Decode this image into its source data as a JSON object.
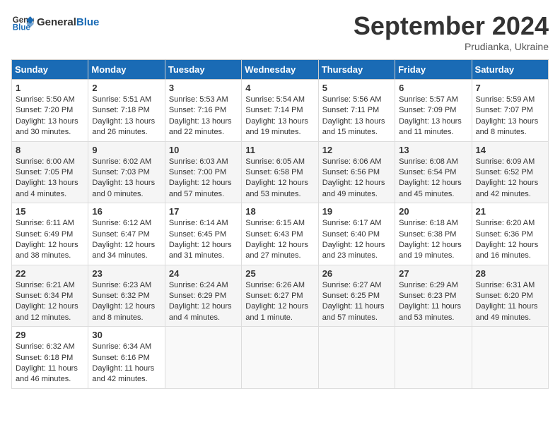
{
  "header": {
    "logo_line1": "General",
    "logo_line2": "Blue",
    "month": "September 2024",
    "location": "Prudianka, Ukraine"
  },
  "weekdays": [
    "Sunday",
    "Monday",
    "Tuesday",
    "Wednesday",
    "Thursday",
    "Friday",
    "Saturday"
  ],
  "weeks": [
    [
      {
        "day": "1",
        "sunrise": "Sunrise: 5:50 AM",
        "sunset": "Sunset: 7:20 PM",
        "daylight": "Daylight: 13 hours and 30 minutes."
      },
      {
        "day": "2",
        "sunrise": "Sunrise: 5:51 AM",
        "sunset": "Sunset: 7:18 PM",
        "daylight": "Daylight: 13 hours and 26 minutes."
      },
      {
        "day": "3",
        "sunrise": "Sunrise: 5:53 AM",
        "sunset": "Sunset: 7:16 PM",
        "daylight": "Daylight: 13 hours and 22 minutes."
      },
      {
        "day": "4",
        "sunrise": "Sunrise: 5:54 AM",
        "sunset": "Sunset: 7:14 PM",
        "daylight": "Daylight: 13 hours and 19 minutes."
      },
      {
        "day": "5",
        "sunrise": "Sunrise: 5:56 AM",
        "sunset": "Sunset: 7:11 PM",
        "daylight": "Daylight: 13 hours and 15 minutes."
      },
      {
        "day": "6",
        "sunrise": "Sunrise: 5:57 AM",
        "sunset": "Sunset: 7:09 PM",
        "daylight": "Daylight: 13 hours and 11 minutes."
      },
      {
        "day": "7",
        "sunrise": "Sunrise: 5:59 AM",
        "sunset": "Sunset: 7:07 PM",
        "daylight": "Daylight: 13 hours and 8 minutes."
      }
    ],
    [
      {
        "day": "8",
        "sunrise": "Sunrise: 6:00 AM",
        "sunset": "Sunset: 7:05 PM",
        "daylight": "Daylight: 13 hours and 4 minutes."
      },
      {
        "day": "9",
        "sunrise": "Sunrise: 6:02 AM",
        "sunset": "Sunset: 7:03 PM",
        "daylight": "Daylight: 13 hours and 0 minutes."
      },
      {
        "day": "10",
        "sunrise": "Sunrise: 6:03 AM",
        "sunset": "Sunset: 7:00 PM",
        "daylight": "Daylight: 12 hours and 57 minutes."
      },
      {
        "day": "11",
        "sunrise": "Sunrise: 6:05 AM",
        "sunset": "Sunset: 6:58 PM",
        "daylight": "Daylight: 12 hours and 53 minutes."
      },
      {
        "day": "12",
        "sunrise": "Sunrise: 6:06 AM",
        "sunset": "Sunset: 6:56 PM",
        "daylight": "Daylight: 12 hours and 49 minutes."
      },
      {
        "day": "13",
        "sunrise": "Sunrise: 6:08 AM",
        "sunset": "Sunset: 6:54 PM",
        "daylight": "Daylight: 12 hours and 45 minutes."
      },
      {
        "day": "14",
        "sunrise": "Sunrise: 6:09 AM",
        "sunset": "Sunset: 6:52 PM",
        "daylight": "Daylight: 12 hours and 42 minutes."
      }
    ],
    [
      {
        "day": "15",
        "sunrise": "Sunrise: 6:11 AM",
        "sunset": "Sunset: 6:49 PM",
        "daylight": "Daylight: 12 hours and 38 minutes."
      },
      {
        "day": "16",
        "sunrise": "Sunrise: 6:12 AM",
        "sunset": "Sunset: 6:47 PM",
        "daylight": "Daylight: 12 hours and 34 minutes."
      },
      {
        "day": "17",
        "sunrise": "Sunrise: 6:14 AM",
        "sunset": "Sunset: 6:45 PM",
        "daylight": "Daylight: 12 hours and 31 minutes."
      },
      {
        "day": "18",
        "sunrise": "Sunrise: 6:15 AM",
        "sunset": "Sunset: 6:43 PM",
        "daylight": "Daylight: 12 hours and 27 minutes."
      },
      {
        "day": "19",
        "sunrise": "Sunrise: 6:17 AM",
        "sunset": "Sunset: 6:40 PM",
        "daylight": "Daylight: 12 hours and 23 minutes."
      },
      {
        "day": "20",
        "sunrise": "Sunrise: 6:18 AM",
        "sunset": "Sunset: 6:38 PM",
        "daylight": "Daylight: 12 hours and 19 minutes."
      },
      {
        "day": "21",
        "sunrise": "Sunrise: 6:20 AM",
        "sunset": "Sunset: 6:36 PM",
        "daylight": "Daylight: 12 hours and 16 minutes."
      }
    ],
    [
      {
        "day": "22",
        "sunrise": "Sunrise: 6:21 AM",
        "sunset": "Sunset: 6:34 PM",
        "daylight": "Daylight: 12 hours and 12 minutes."
      },
      {
        "day": "23",
        "sunrise": "Sunrise: 6:23 AM",
        "sunset": "Sunset: 6:32 PM",
        "daylight": "Daylight: 12 hours and 8 minutes."
      },
      {
        "day": "24",
        "sunrise": "Sunrise: 6:24 AM",
        "sunset": "Sunset: 6:29 PM",
        "daylight": "Daylight: 12 hours and 4 minutes."
      },
      {
        "day": "25",
        "sunrise": "Sunrise: 6:26 AM",
        "sunset": "Sunset: 6:27 PM",
        "daylight": "Daylight: 12 hours and 1 minute."
      },
      {
        "day": "26",
        "sunrise": "Sunrise: 6:27 AM",
        "sunset": "Sunset: 6:25 PM",
        "daylight": "Daylight: 11 hours and 57 minutes."
      },
      {
        "day": "27",
        "sunrise": "Sunrise: 6:29 AM",
        "sunset": "Sunset: 6:23 PM",
        "daylight": "Daylight: 11 hours and 53 minutes."
      },
      {
        "day": "28",
        "sunrise": "Sunrise: 6:31 AM",
        "sunset": "Sunset: 6:20 PM",
        "daylight": "Daylight: 11 hours and 49 minutes."
      }
    ],
    [
      {
        "day": "29",
        "sunrise": "Sunrise: 6:32 AM",
        "sunset": "Sunset: 6:18 PM",
        "daylight": "Daylight: 11 hours and 46 minutes."
      },
      {
        "day": "30",
        "sunrise": "Sunrise: 6:34 AM",
        "sunset": "Sunset: 6:16 PM",
        "daylight": "Daylight: 11 hours and 42 minutes."
      },
      null,
      null,
      null,
      null,
      null
    ]
  ]
}
